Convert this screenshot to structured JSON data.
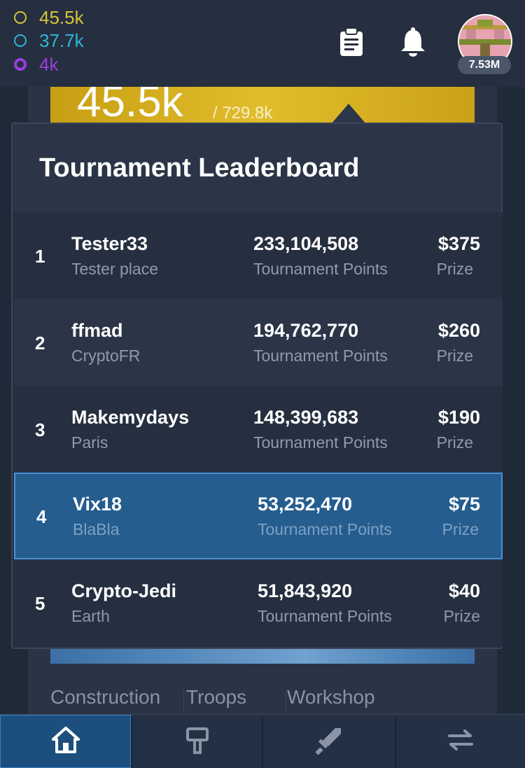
{
  "resources": {
    "gold": "45.5k",
    "cyan": "37.7k",
    "purple": "4k"
  },
  "header": {
    "balance": "7.53M"
  },
  "background": {
    "big_value": "45.5k",
    "big_max": "/ 729.8k",
    "tabs": [
      "Construction",
      "Troops",
      "Workshop"
    ]
  },
  "leaderboard": {
    "title": "Tournament Leaderboard",
    "rows": [
      {
        "rank": "1",
        "name": "Tester33",
        "location": "Tester place",
        "points": "233,104,508",
        "points_label": "Tournament Points",
        "prize": "$375",
        "prize_label": "Prize"
      },
      {
        "rank": "2",
        "name": "ffmad",
        "location": "CryptoFR",
        "points": "194,762,770",
        "points_label": "Tournament Points",
        "prize": "$260",
        "prize_label": "Prize"
      },
      {
        "rank": "3",
        "name": "Makemydays",
        "location": "Paris",
        "points": "148,399,683",
        "points_label": "Tournament Points",
        "prize": "$190",
        "prize_label": "Prize"
      },
      {
        "rank": "4",
        "name": "Vix18",
        "location": "BlaBla",
        "points": "53,252,470",
        "points_label": "Tournament Points",
        "prize": "$75",
        "prize_label": "Prize"
      },
      {
        "rank": "5",
        "name": "Crypto-Jedi",
        "location": "Earth",
        "points": "51,843,920",
        "points_label": "Tournament Points",
        "prize": "$40",
        "prize_label": "Prize"
      }
    ]
  },
  "colors": {
    "gold": "#d8c43a",
    "cyan": "#2fb5d8",
    "purple": "#9b3de0",
    "highlight": "#255d8f"
  },
  "icons": {
    "header": [
      "clipboard-icon",
      "bell-icon"
    ],
    "nav": [
      "home-icon",
      "hammer-icon",
      "sword-icon",
      "swap-arrows-icon"
    ]
  }
}
